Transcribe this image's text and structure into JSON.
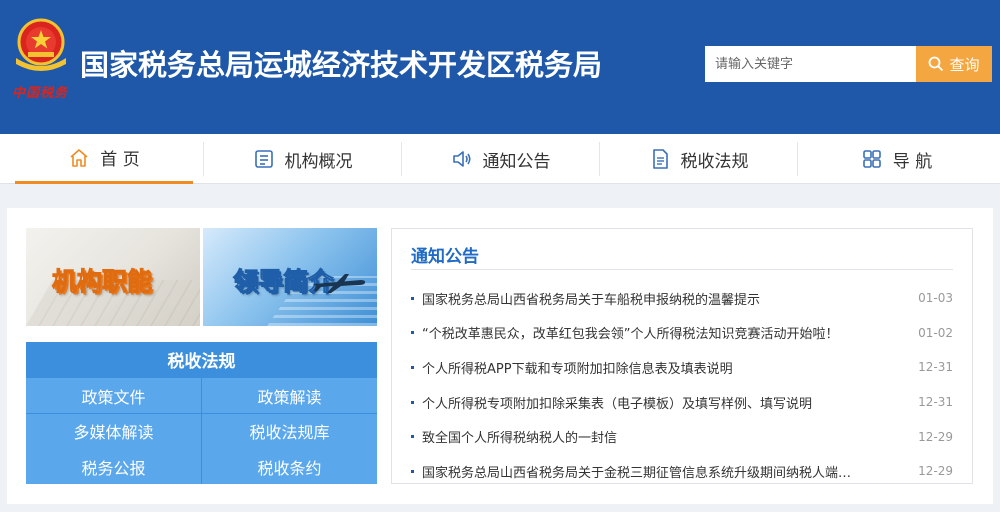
{
  "header": {
    "emblem_text": "中国税务",
    "title": "国家税务总局运城经济技术开发区税务局",
    "search_placeholder": "请输入关键字",
    "search_button": "查询",
    "colors": {
      "header_bg": "#1f58a8",
      "search_btn": "#f4a640"
    }
  },
  "nav": {
    "items": [
      {
        "label": "首 页",
        "icon": "home-icon",
        "active": true
      },
      {
        "label": "机构概况",
        "icon": "org-icon",
        "active": false
      },
      {
        "label": "通知公告",
        "icon": "speaker-icon",
        "active": false
      },
      {
        "label": "税收法规",
        "icon": "document-icon",
        "active": false
      },
      {
        "label": "导 航",
        "icon": "grid-icon",
        "active": false
      }
    ],
    "active_color": "#f08b21"
  },
  "banners": [
    {
      "label": "机构职能"
    },
    {
      "label": "领导简介"
    }
  ],
  "tax_law": {
    "title": "税收法规",
    "links": [
      "政策文件",
      "政策解读",
      "多媒体解读",
      "税收法规库",
      "税务公报",
      "税收条约"
    ]
  },
  "notices": {
    "title": "通知公告",
    "items": [
      {
        "text": "国家税务总局山西省税务局关于车船税申报纳税的温馨提示",
        "date": "01-03"
      },
      {
        "text": "“个税改革惠民众，改革红包我会领”个人所得税法知识竞赛活动开始啦！",
        "date": "01-02"
      },
      {
        "text": "个人所得税APP下载和专项附加扣除信息表及填表说明",
        "date": "12-31"
      },
      {
        "text": "个人所得税专项附加扣除采集表（电子模板）及填写样例、填写说明",
        "date": "12-31"
      },
      {
        "text": "致全国个人所得税纳税人的一封信",
        "date": "12-29"
      },
      {
        "text": "国家税务总局山西省税务局关于金税三期征管信息系统升级期间纳税人端…",
        "date": "12-29"
      }
    ]
  }
}
